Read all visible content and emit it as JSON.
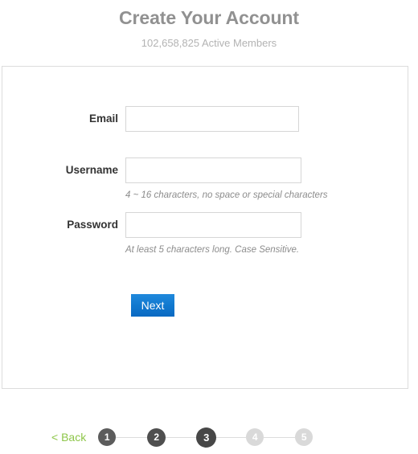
{
  "header": {
    "title": "Create Your Account",
    "subtitle": "102,658,825 Active Members"
  },
  "form": {
    "fields": [
      {
        "label": "Email",
        "value": "",
        "placeholder": "",
        "hint": ""
      },
      {
        "label": "Username",
        "value": "",
        "placeholder": "",
        "hint": "4 ~ 16 characters, no space or special characters"
      },
      {
        "label": "Password",
        "value": "",
        "placeholder": "",
        "hint": "At least 5 characters long. Case Sensitive."
      }
    ],
    "submit_label": "Next"
  },
  "wizard": {
    "back_label": "< Back",
    "steps": [
      {
        "number": "1",
        "state": "done"
      },
      {
        "number": "2",
        "state": "done"
      },
      {
        "number": "3",
        "state": "current"
      },
      {
        "number": "4",
        "state": "upcoming"
      },
      {
        "number": "5",
        "state": "upcoming"
      }
    ]
  },
  "colors": {
    "title_gray": "#919191",
    "subtitle_gray": "#b3b3b3",
    "label_dark": "#333333",
    "hint_gray": "#8c8c8c",
    "button_blue": "#1179cf",
    "back_green": "#8ec64a",
    "step_active": "#4f4f4f",
    "step_inactive": "#d9d9d9",
    "border_gray": "#dcdcdc"
  }
}
